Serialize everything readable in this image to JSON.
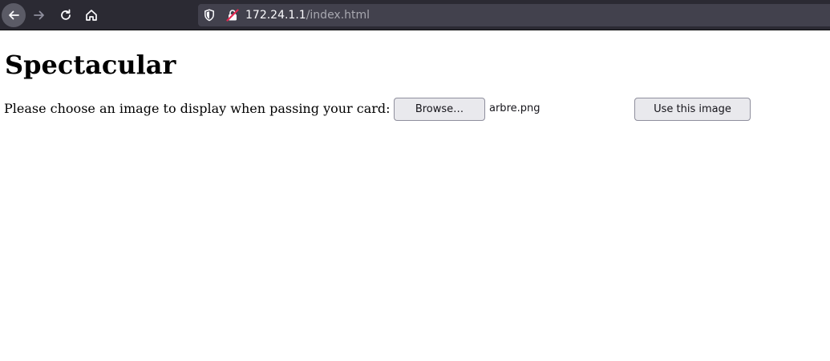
{
  "browser": {
    "url_host": "172.24.1.1",
    "url_path": "/index.html",
    "nav": {
      "back_icon": "arrow-left-icon",
      "forward_icon": "arrow-right-icon",
      "reload_icon": "reload-icon",
      "home_icon": "home-icon"
    }
  },
  "page": {
    "heading": "Spectacular",
    "prompt": "Please choose an image to display when passing your card:",
    "browse_label": "Browse…",
    "selected_file": "arbre.png",
    "submit_label": "Use this image"
  }
}
